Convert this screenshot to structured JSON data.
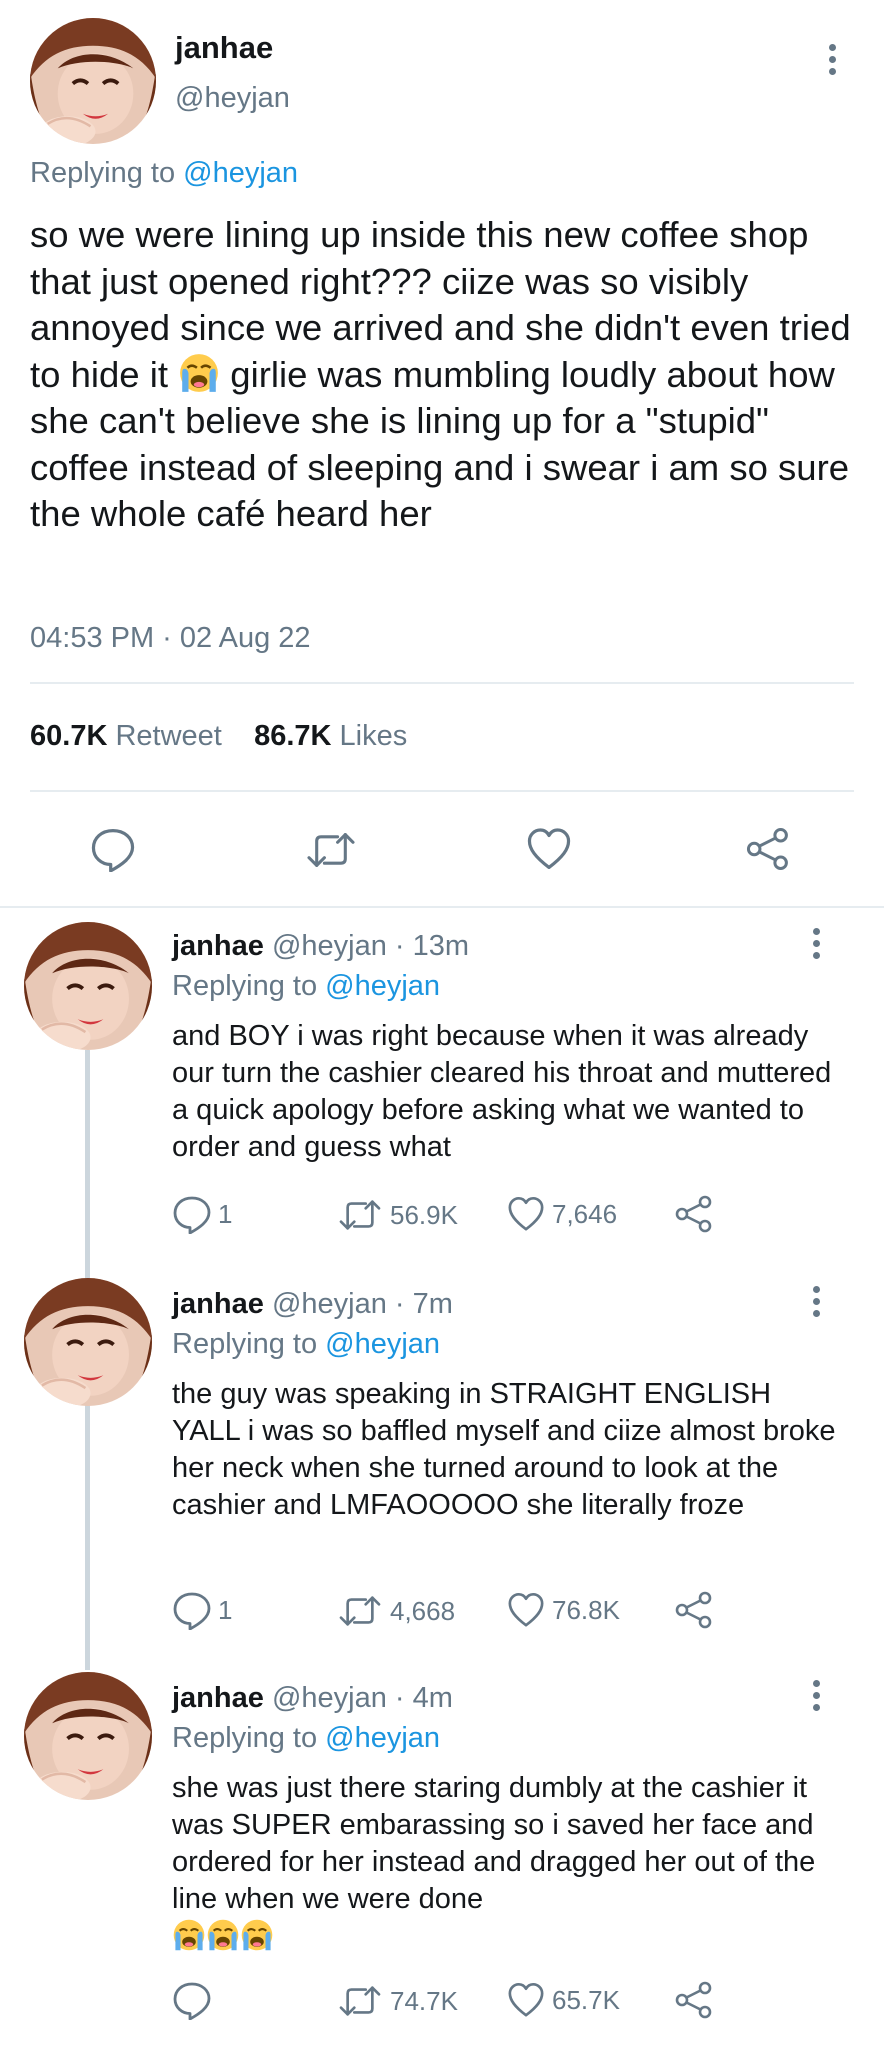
{
  "main_tweet": {
    "display_name": "janhae",
    "handle": "@heyjan",
    "replying_prefix": "Replying to",
    "replying_handle": "@heyjan",
    "text_part1": "so we were lining up inside this new coffee shop that just opened right??? ciize was so visibly annoyed since we arrived and she didn't even tried to hide it",
    "text_part2": "girlie was mumbling loudly about how she can't believe she is lining up for a \"stupid\" coffee instead of sleeping and i swear i am so sure the whole café heard her",
    "timestamp": "04:53 PM · 02 Aug 22",
    "retweet_count": "60.7K",
    "retweet_label": "Retweet",
    "like_count": "86.7K",
    "like_label": "Likes"
  },
  "replies": [
    {
      "display_name": "janhae",
      "meta": "@heyjan · 13m",
      "replying_prefix": "Replying to",
      "replying_handle": "@heyjan",
      "text": "and BOY i was right because when it was already our turn the cashier cleared his throat and muttered a quick apology before asking what we wanted to order and guess what",
      "reply_count": "1",
      "retweet_count": "56.9K",
      "like_count": "7,646"
    },
    {
      "display_name": "janhae",
      "meta": "@heyjan · 7m",
      "replying_prefix": "Replying to",
      "replying_handle": "@heyjan",
      "text": "the guy was speaking in STRAIGHT ENGLISH YALL i was so baffled myself and ciize almost broke her neck when she turned around to look at the cashier and LMFAOOOOO she literally froze",
      "reply_count": "1",
      "retweet_count": "4,668",
      "like_count": "76.8K"
    },
    {
      "display_name": "janhae",
      "meta": "@heyjan · 4m",
      "replying_prefix": "Replying to",
      "replying_handle": "@heyjan",
      "text": "she was just there staring dumbly at the cashier it was SUPER embarassing so i saved her face and ordered for her instead and dragged her out of the line when we were done",
      "reply_count": "",
      "retweet_count": "74.7K",
      "like_count": "65.7K"
    }
  ],
  "icons": {
    "reply": "reply-icon",
    "retweet": "retweet-icon",
    "like": "heart-icon",
    "share": "share-icon",
    "more": "more-options-icon",
    "emoji": "loudly-crying-face-emoji"
  },
  "colors": {
    "text": "#14171a",
    "secondary": "#657786",
    "link": "#1b95e0",
    "divider": "#e6ecf0",
    "thread_line": "#ccd6dd"
  }
}
